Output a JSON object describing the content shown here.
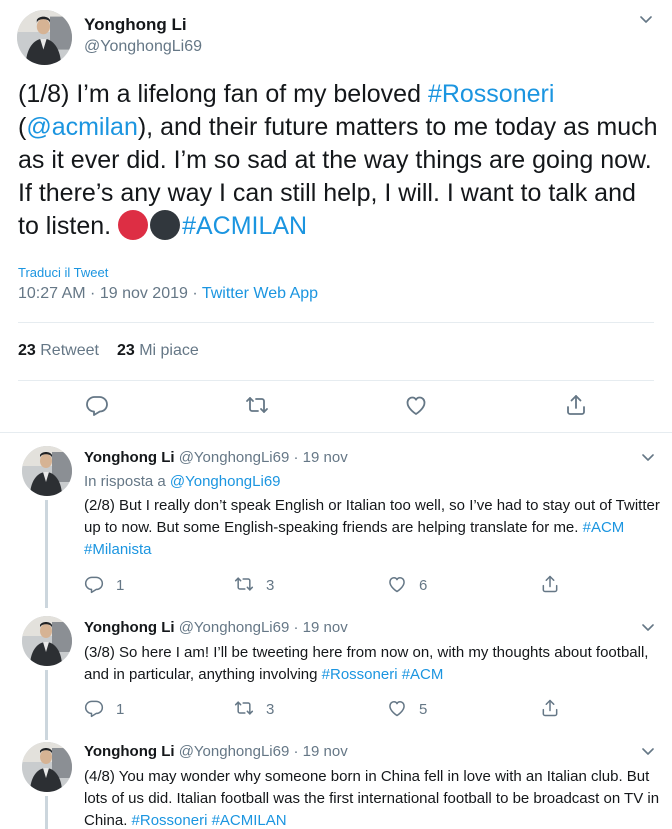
{
  "main_tweet": {
    "author_name": "Yonghong Li",
    "author_handle": "@YonghongLi69",
    "text_prefix": "(1/8) I’m a lifelong fan of my beloved ",
    "hashtag_rossoneri": "#Rossoneri",
    "text_open_paren": " (",
    "mention_acmilan": "@acmilan",
    "text_middle": "), and their future matters to me today as much as it ever did.  I’m so sad at the way things are going now.  If there’s any way I can still help, I will. I want to talk and to listen. ",
    "emoji_red": "red-circle",
    "emoji_black": "black-circle",
    "hashtag_acmilan": "#ACMILAN",
    "translate_label": "Traduci il Tweet",
    "timestamp": "10:27 AM · 19 nov 2019 · ",
    "source_app": "Twitter Web App",
    "retweet_count": "23",
    "retweet_label": "Retweet",
    "like_count": "23",
    "like_label": "Mi piace"
  },
  "replies": [
    {
      "author_name": "Yonghong Li",
      "author_handle": "@YonghongLi69",
      "time": "· 19 nov",
      "in_reply_prefix": "In risposta a ",
      "in_reply_handle": "@YonghongLi69",
      "text": "(2/8) But I really don’t speak English or Italian too well, so I’ve had to stay out of Twitter up to now. But some English-speaking friends are helping translate for me. ",
      "hashtags": [
        "#ACM",
        "#Milanista"
      ],
      "reply_count": "1",
      "retweet_count": "3",
      "like_count": "6"
    },
    {
      "author_name": "Yonghong Li",
      "author_handle": "@YonghongLi69",
      "time": "· 19 nov",
      "text": "(3/8) So here I am! I’ll be tweeting here from now on, with my thoughts about football, and in particular, anything involving ",
      "hashtags": [
        "#Rossoneri",
        "#ACM"
      ],
      "reply_count": "1",
      "retweet_count": "3",
      "like_count": "5"
    },
    {
      "author_name": "Yonghong Li",
      "author_handle": "@YonghongLi69",
      "time": "· 19 nov",
      "text": "(4/8) You may wonder why someone born in China fell in love with an Italian club. But lots of us did. Italian football was the first international football to be broadcast on TV in China. ",
      "hashtags": [
        "#Rossoneri",
        "#ACMILAN"
      ]
    }
  ],
  "colors": {
    "link": "#1b95e0",
    "secondary_text": "#657786",
    "primary_text": "#14171a",
    "divider": "#e6ecf0",
    "emoji_red": "#dd2e44",
    "emoji_black": "#31373d"
  },
  "icons": [
    "chevron-down-icon",
    "reply-icon",
    "retweet-icon",
    "like-icon",
    "share-icon"
  ]
}
